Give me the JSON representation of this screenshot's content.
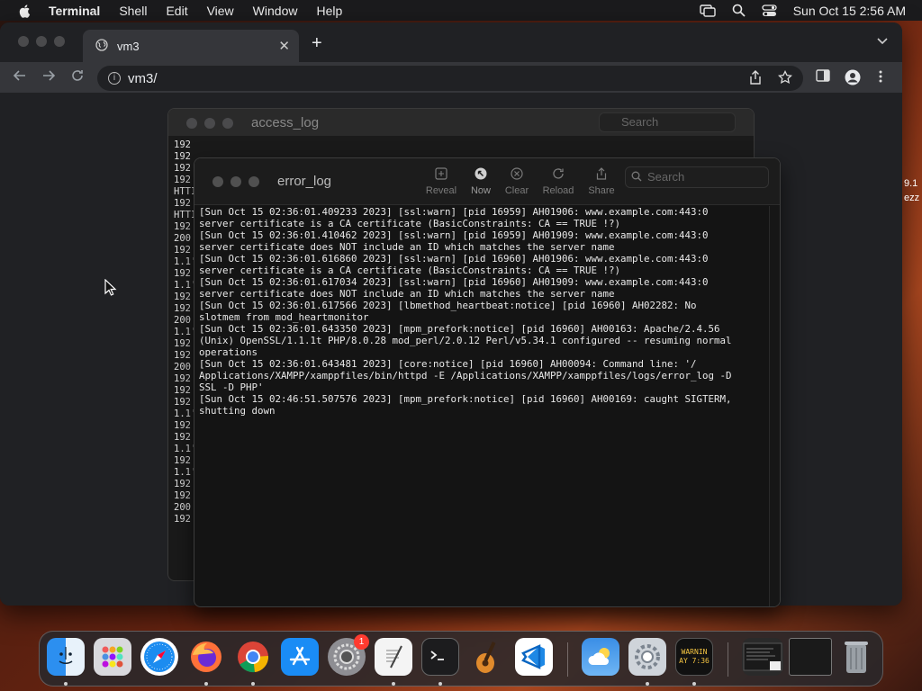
{
  "menubar": {
    "app": "Terminal",
    "items": [
      "Shell",
      "Edit",
      "View",
      "Window",
      "Help"
    ],
    "clock": "Sun Oct 15  2:56 AM"
  },
  "browser": {
    "tab_title": "vm3",
    "url": "vm3/"
  },
  "terminal_back": {
    "title": "access_log",
    "search_placeholder": "Search",
    "lines": [
      "192",
      "192",
      "192",
      "192",
      "HTTI",
      "192",
      "HTTI",
      "192",
      "200",
      "192",
      "1.1'",
      "192",
      "1.1'",
      "192",
      "192",
      "200",
      "1.1'",
      "192",
      "192",
      "200",
      "192",
      "192",
      "192",
      "1.1'",
      "192",
      "192",
      "1.1'",
      "192",
      "1.1'",
      "192",
      "192",
      "200",
      "192"
    ]
  },
  "terminal_front": {
    "title": "error_log",
    "toolbar": {
      "reveal": "Reveal",
      "now": "Now",
      "clear": "Clear",
      "reload": "Reload",
      "share": "Share"
    },
    "search_placeholder": "Search",
    "log_lines": [
      "[Sun Oct 15 02:36:01.409233 2023] [ssl:warn] [pid 16959] AH01906: www.example.com:443:0",
      "server certificate is a CA certificate (BasicConstraints: CA == TRUE !?)",
      "[Sun Oct 15 02:36:01.410462 2023] [ssl:warn] [pid 16959] AH01909: www.example.com:443:0",
      "server certificate does NOT include an ID which matches the server name",
      "[Sun Oct 15 02:36:01.616860 2023] [ssl:warn] [pid 16960] AH01906: www.example.com:443:0",
      "server certificate is a CA certificate (BasicConstraints: CA == TRUE !?)",
      "[Sun Oct 15 02:36:01.617034 2023] [ssl:warn] [pid 16960] AH01909: www.example.com:443:0",
      "server certificate does NOT include an ID which matches the server name",
      "[Sun Oct 15 02:36:01.617566 2023] [lbmethod_heartbeat:notice] [pid 16960] AH02282: No",
      "slotmem from mod_heartmonitor",
      "[Sun Oct 15 02:36:01.643350 2023] [mpm_prefork:notice] [pid 16960] AH00163: Apache/2.4.56",
      "(Unix) OpenSSL/1.1.1t PHP/8.0.28 mod_perl/2.0.12 Perl/v5.34.1 configured -- resuming normal",
      "operations",
      "[Sun Oct 15 02:36:01.643481 2023] [core:notice] [pid 16960] AH00094: Command line: '/",
      "Applications/XAMPP/xamppfiles/bin/httpd -E /Applications/XAMPP/xamppfiles/logs/error_log -D",
      "SSL -D PHP'",
      "[Sun Oct 15 02:46:51.507576 2023] [mpm_prefork:notice] [pid 16960] AH00169: caught SIGTERM,",
      "shutting down"
    ]
  },
  "desktop_peek": [
    "9.1",
    "ezz"
  ],
  "dock": {
    "settings_badge": "1",
    "console_label_1": "WARNIN",
    "console_label_2": "AY 7:36"
  },
  "colors": {
    "menubar_bg": "#1b1b1d",
    "browser_bg": "#202124",
    "terminal_bg": "#141414",
    "badge": "#ff3b30"
  }
}
